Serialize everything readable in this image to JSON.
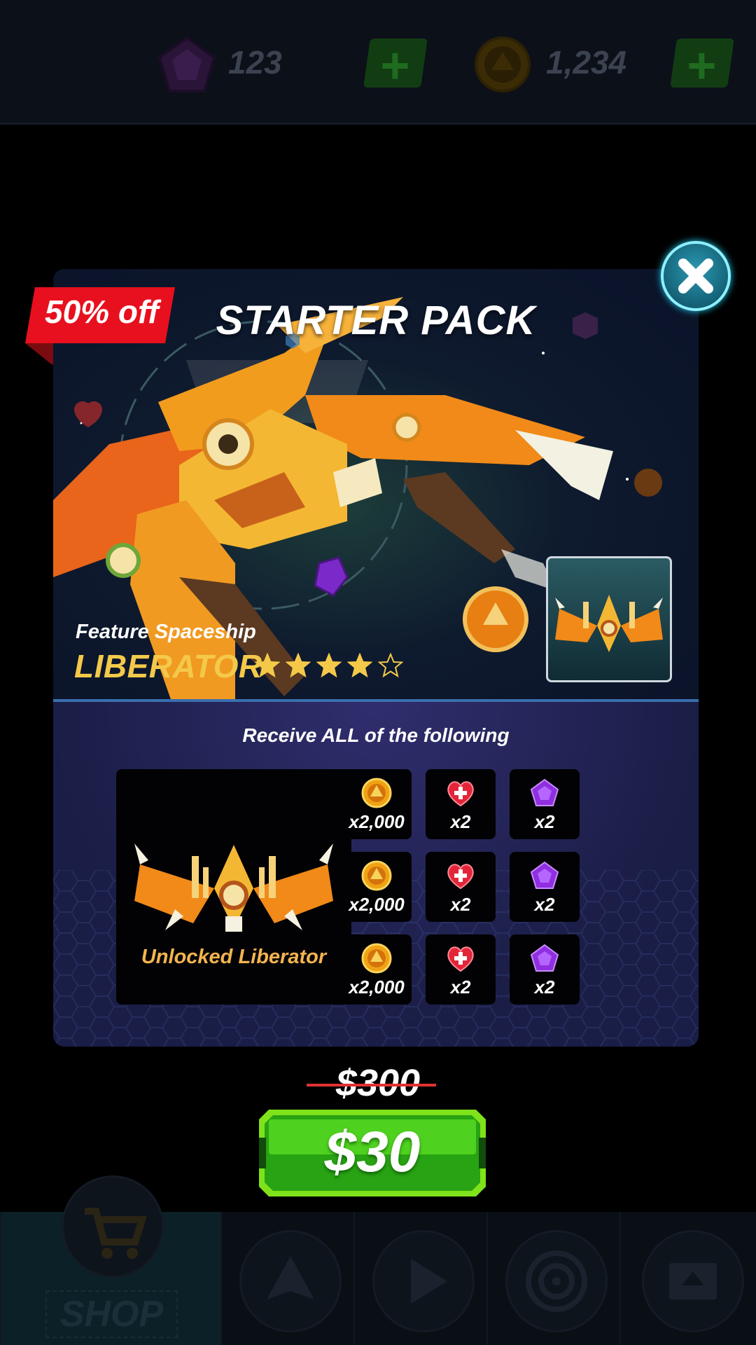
{
  "currency": {
    "gems": {
      "icon": "gem-icon",
      "value": "123"
    },
    "coins": {
      "icon": "coin-icon",
      "value": "1,234"
    }
  },
  "nav": {
    "shop_label": "SHOP",
    "items": [
      "cart-icon",
      "ship-icon",
      "play-icon",
      "target-icon",
      "upgrade-icon"
    ]
  },
  "offer": {
    "badge": "50% off",
    "title": "STARTER PACK",
    "feature_label": "Feature Spaceship",
    "ship_name": "LIBERATOR",
    "rating": 4,
    "rating_max": 5,
    "receive_text": "Receive ALL of the following",
    "unlock_label": "Unlocked Liberator",
    "rewards": [
      {
        "icon": "coin-icon",
        "qty": "x2,000"
      },
      {
        "icon": "heart-icon",
        "qty": "x2"
      },
      {
        "icon": "gem-icon",
        "qty": "x2"
      },
      {
        "icon": "coin-icon",
        "qty": "x2,000"
      },
      {
        "icon": "heart-icon",
        "qty": "x2"
      },
      {
        "icon": "gem-icon",
        "qty": "x2"
      },
      {
        "icon": "coin-icon",
        "qty": "x2,000"
      },
      {
        "icon": "heart-icon",
        "qty": "x2"
      },
      {
        "icon": "gem-icon",
        "qty": "x2"
      }
    ],
    "old_price": "$300",
    "price": "$30"
  },
  "colors": {
    "accent_gold": "#f4c94a",
    "buy_green": "#32c11a",
    "badge_red": "#e8101e"
  }
}
